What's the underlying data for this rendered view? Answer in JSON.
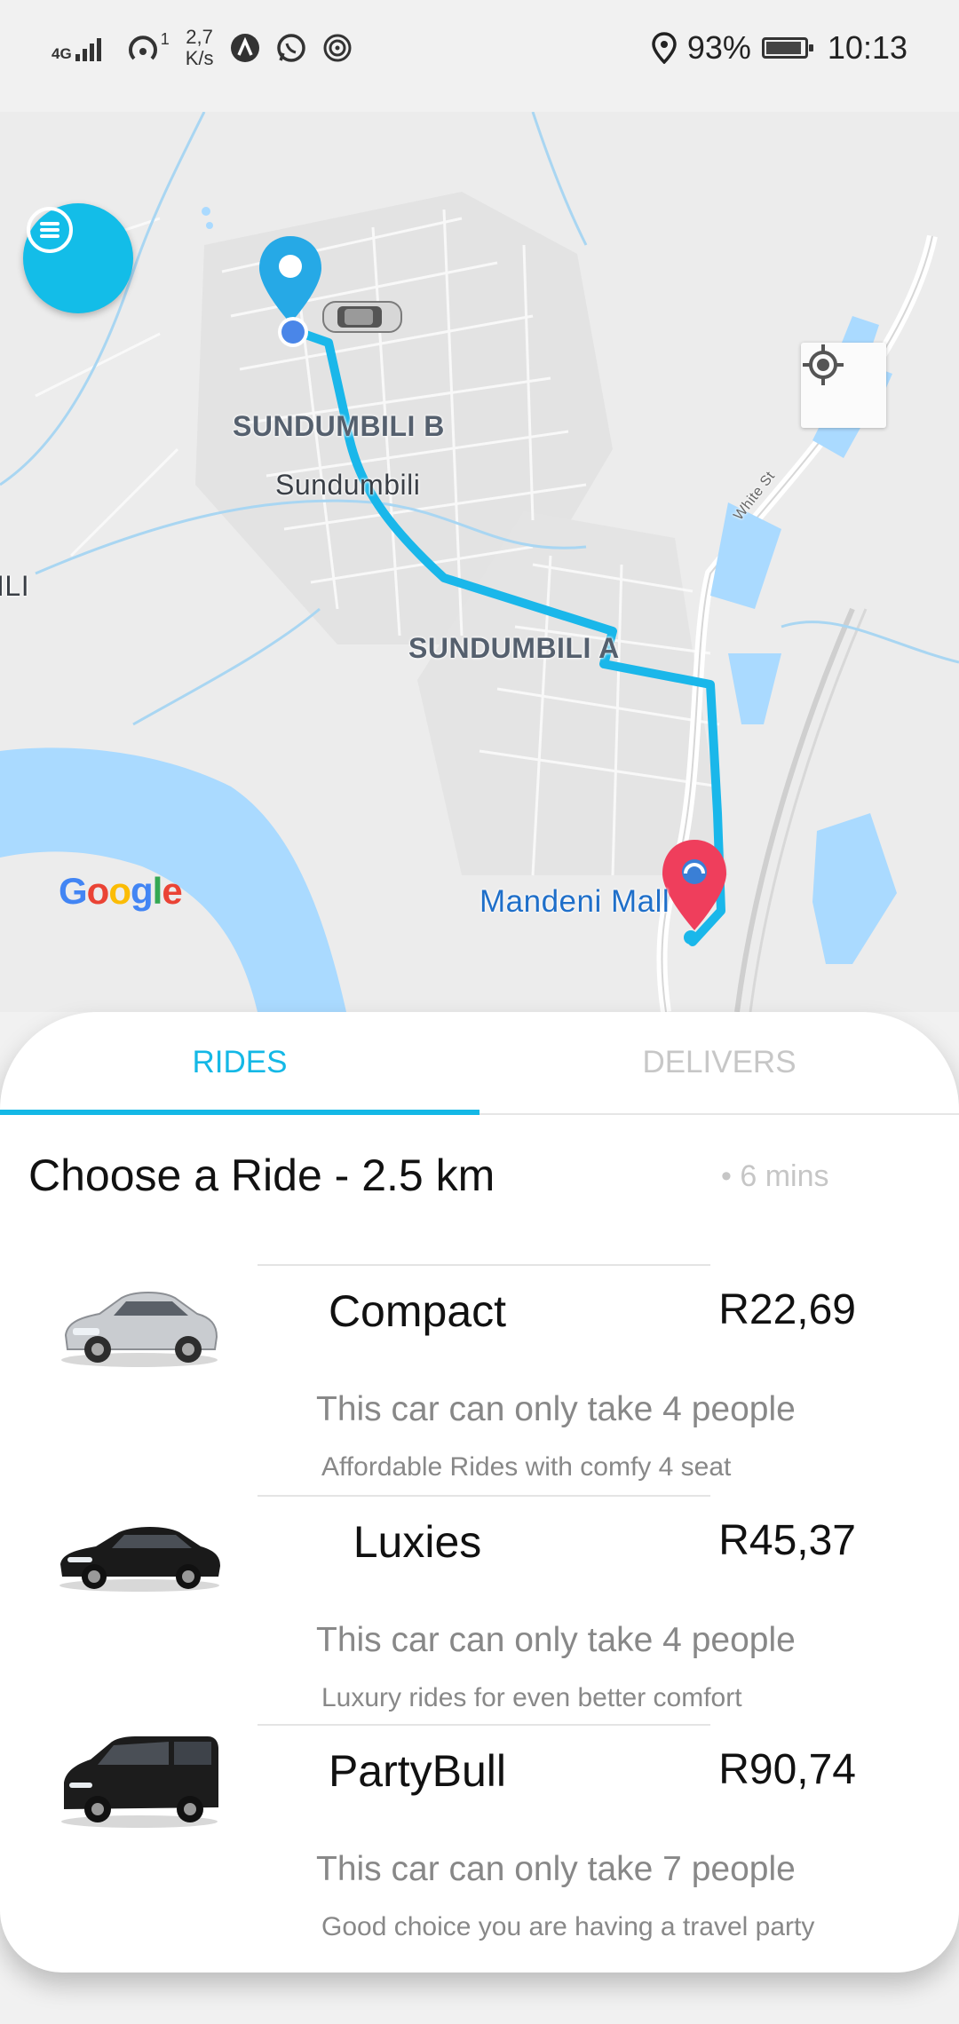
{
  "status_bar": {
    "network": "4G",
    "hotspot_count": "1",
    "speed_value": "2,7",
    "speed_unit": "K/s",
    "battery_percent": "93%",
    "battery_level": 0.93,
    "time": "10:13"
  },
  "map": {
    "labels": {
      "area_b": "SUNDUMBILI B",
      "town": "Sundumbili",
      "area_a": "SUNDUMBILI A",
      "edge": "ILI",
      "street": "White St",
      "destination": "Mandeni Mall"
    },
    "google_logo": [
      "G",
      "o",
      "o",
      "g",
      "l",
      "e"
    ],
    "google_colors": [
      "#4285F4",
      "#EA4335",
      "#FBBC05",
      "#4285F4",
      "#34A853",
      "#EA4335"
    ],
    "route_color": "#1ab7ea",
    "water_color": "#aadaff",
    "icons": {
      "menu": "menu-icon",
      "locate": "my-location-icon",
      "origin": "origin-pin-icon",
      "destination": "destination-pin-icon",
      "car": "car-icon"
    }
  },
  "tabs": [
    {
      "label": "RIDES",
      "active": true
    },
    {
      "label": "DELIVERS",
      "active": false
    }
  ],
  "trip": {
    "title": "Choose a Ride - 2.5 km",
    "eta": "• 6 mins"
  },
  "rides": [
    {
      "name": "Compact",
      "price": "R22,69",
      "capacity": "This car can only take 4 people",
      "description": "Affordable Rides with comfy 4 seat",
      "car_color": "#c9ccd0",
      "image": "silver-sedan"
    },
    {
      "name": "Luxies",
      "price": "R45,37",
      "capacity": "This car can only take 4 people",
      "description": "Luxury rides for even better comfort",
      "car_color": "#1a1a1a",
      "image": "black-luxury-sedan"
    },
    {
      "name": "PartyBull",
      "price": "R90,74",
      "capacity": "This car can only take 7 people",
      "description": "Good choice you are having a travel party",
      "car_color": "#1c1c1c",
      "image": "black-van"
    }
  ],
  "colors": {
    "accent": "#14b8e6",
    "destination_pin": "#ef3e5c",
    "origin_pin": "#26a9e6"
  }
}
